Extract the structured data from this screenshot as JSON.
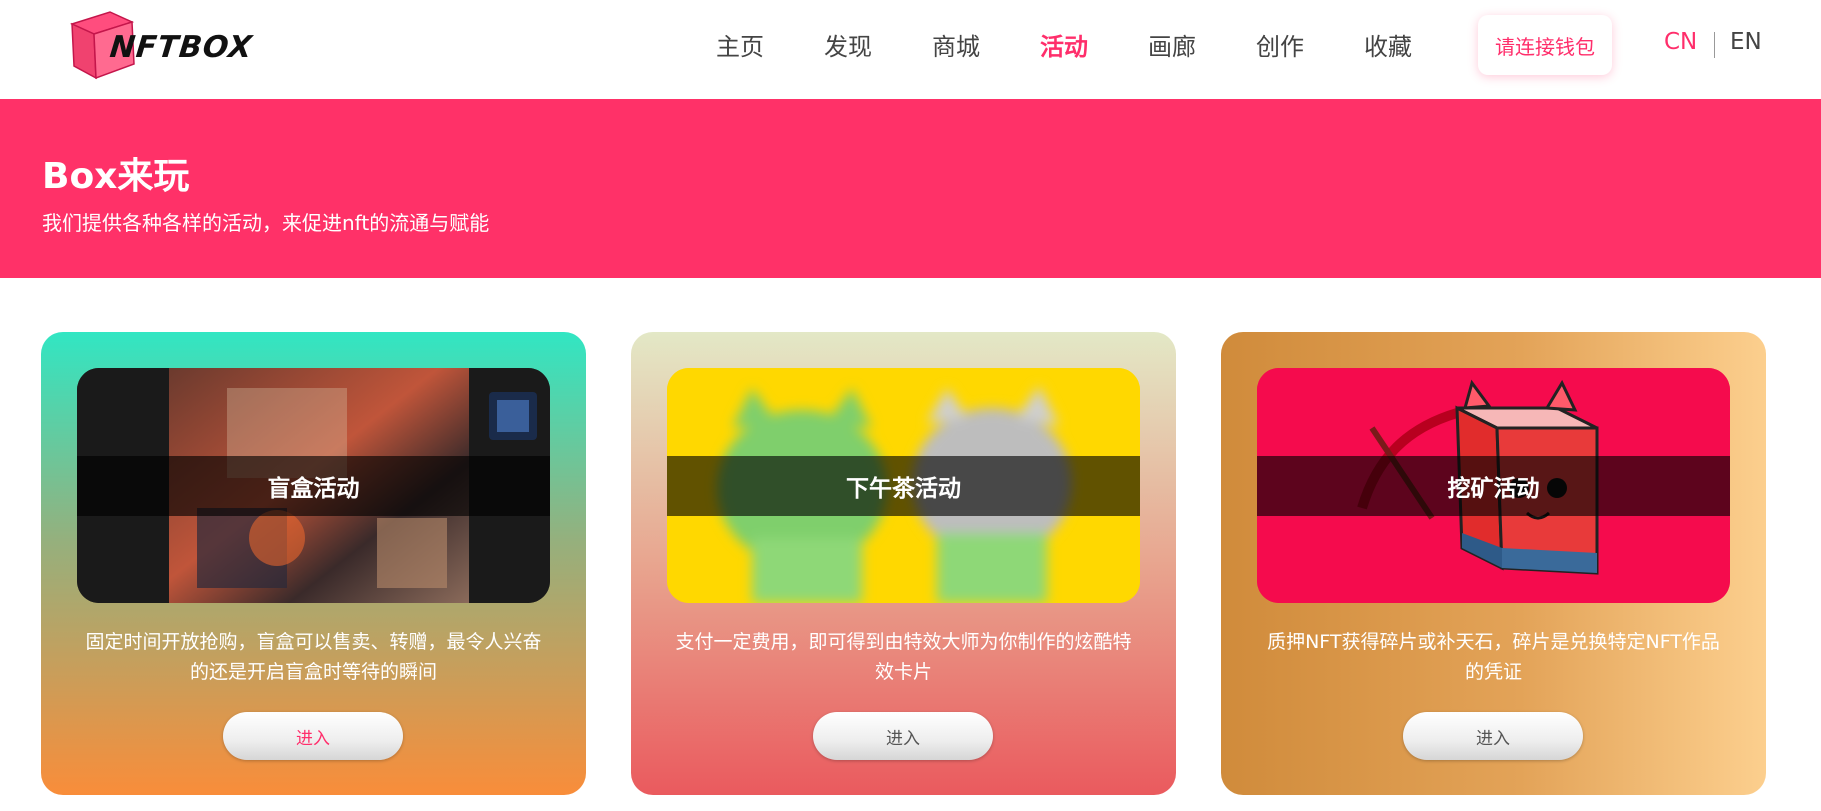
{
  "header": {
    "logo_text": "NFTBOX",
    "nav": [
      {
        "label": "主页",
        "active": false
      },
      {
        "label": "发现",
        "active": false
      },
      {
        "label": "商城",
        "active": false
      },
      {
        "label": "活动",
        "active": true
      },
      {
        "label": "画廊",
        "active": false
      },
      {
        "label": "创作",
        "active": false
      },
      {
        "label": "收藏",
        "active": false
      }
    ],
    "wallet_button": "请连接钱包",
    "lang": {
      "cn": "CN",
      "en": "EN",
      "active": "CN"
    }
  },
  "banner": {
    "title": "Box来玩",
    "subtitle": "我们提供各种各样的活动，来促进nft的流通与赋能"
  },
  "cards": [
    {
      "title": "盲盒活动",
      "description": "固定时间开放抢购，盲盒可以售卖、转赠，最令人兴奋的还是开启盲盒时等待的瞬间",
      "button": "进入"
    },
    {
      "title": "下午茶活动",
      "description": "支付一定费用，即可得到由特效大师为你制作的炫酷特效卡片",
      "button": "进入"
    },
    {
      "title": "挖矿活动",
      "description": "质押NFT获得碎片或补天石，碎片是兑换特定NFT作品的凭证",
      "button": "进入"
    }
  ],
  "colors": {
    "accent": "#ff2e6b",
    "banner": "#ff3168"
  },
  "icons": [
    "logo-box-icon"
  ]
}
